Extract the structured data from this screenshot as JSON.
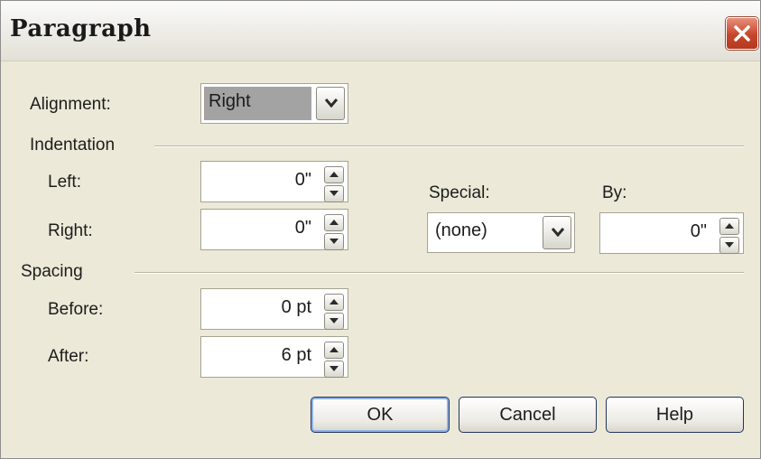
{
  "window": {
    "title": "Paragraph"
  },
  "alignment": {
    "label": "Alignment:",
    "value": "Right"
  },
  "indentation": {
    "group_label": "Indentation",
    "left_label": "Left:",
    "left_value": "0\"",
    "right_label": "Right:",
    "right_value": "0\"",
    "special_label": "Special:",
    "special_value": "(none)",
    "by_label": "By:",
    "by_value": "0\""
  },
  "spacing": {
    "group_label": "Spacing",
    "before_label": "Before:",
    "before_value": "0 pt",
    "after_label": "After:",
    "after_value": "6 pt"
  },
  "buttons": {
    "ok": "OK",
    "cancel": "Cancel",
    "help": "Help"
  }
}
